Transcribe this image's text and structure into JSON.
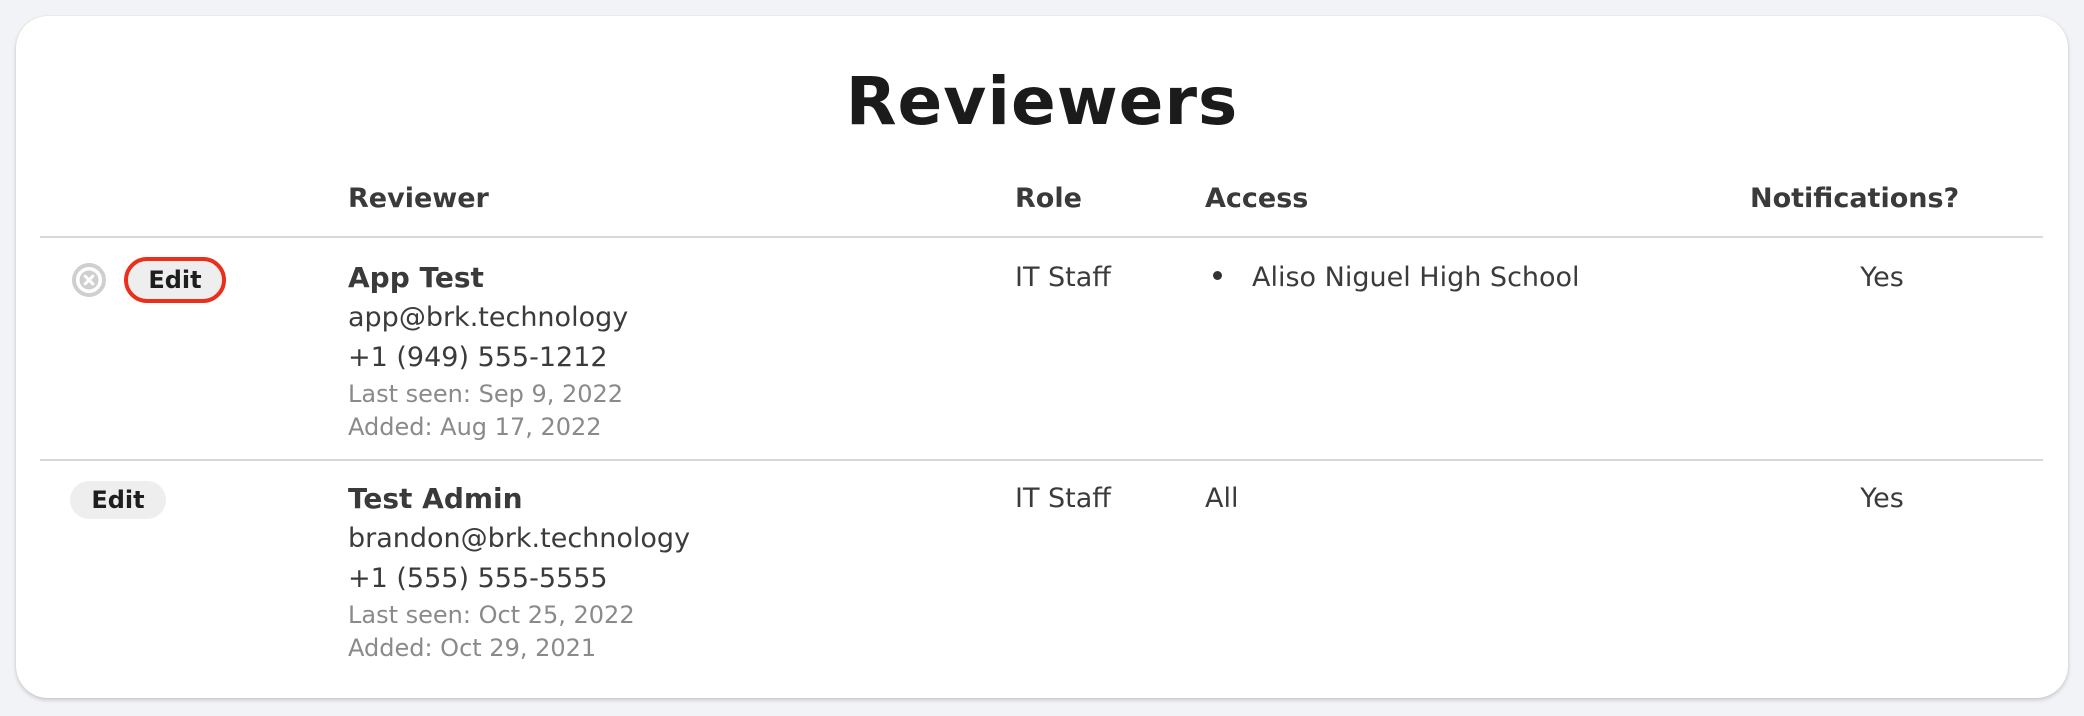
{
  "page": {
    "title": "Reviewers"
  },
  "table": {
    "headers": {
      "reviewer": "Reviewer",
      "role": "Role",
      "access": "Access",
      "notifications": "Notifications?"
    },
    "rows": [
      {
        "edit_label": "Edit",
        "has_remove_icon": true,
        "name": "App Test",
        "email": "app@brk.technology",
        "phone": "+1 (949) 555-1212",
        "last_seen": "Last seen: Sep 9, 2022",
        "added": "Added: Aug 17, 2022",
        "role": "IT Staff",
        "access": "Aliso Niguel High School",
        "access_is_list": true,
        "notifications": "Yes"
      },
      {
        "edit_label": "Edit",
        "has_remove_icon": false,
        "name": "Test Admin",
        "email": "brandon@brk.technology",
        "phone": "+1 (555) 555-5555",
        "last_seen": "Last seen: Oct 25, 2022",
        "added": "Added: Oct 29, 2021",
        "role": "IT Staff",
        "access": "All",
        "access_is_list": false,
        "notifications": "Yes"
      }
    ]
  },
  "colors": {
    "page_background": "#f2f3f6",
    "card_background": "#ffffff",
    "highlight_ring": "#e8301c",
    "button_background": "#eeeeef",
    "muted_text": "#8a8a8a"
  },
  "icons": {
    "remove": "remove-circle-x-icon",
    "bullet": "bullet-dot-icon"
  }
}
